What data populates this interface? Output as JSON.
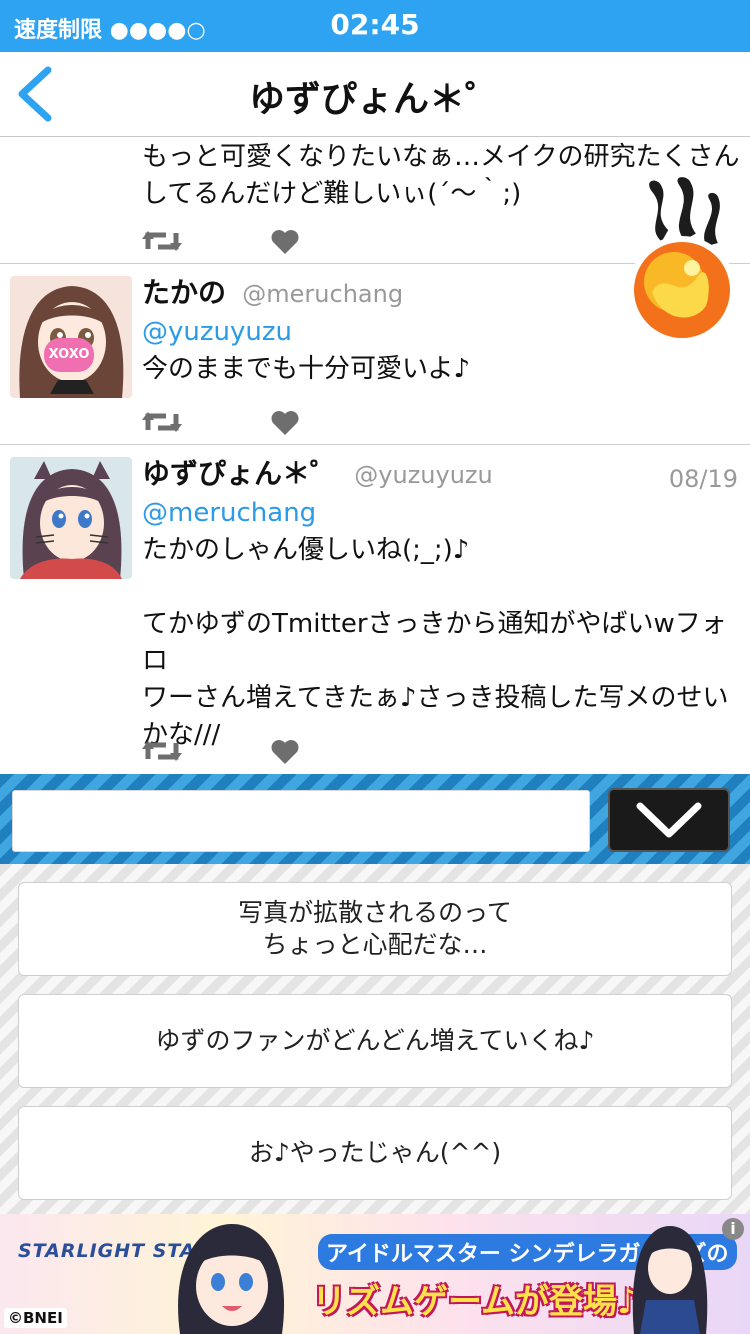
{
  "status_bar": {
    "carrier": "速度制限 ●●●●○",
    "time": "02:45"
  },
  "nav": {
    "title": "ゆずぴょん＊゜"
  },
  "tweets": [
    {
      "name": "",
      "handle": "",
      "date": "",
      "mention": "",
      "lines": [
        "もっと可愛くなりたいなぁ…メイクの研究たくさん",
        "してるんだけど難しいぃ(´〜｀;)"
      ]
    },
    {
      "name": "たかの",
      "handle": "@meruchang",
      "date": "",
      "mention": "@yuzuyuzu",
      "lines": [
        "今のままでも十分可愛いよ♪"
      ]
    },
    {
      "name": "ゆずぴょん＊゜",
      "handle": "@yuzuyuzu",
      "date": "08/19",
      "mention": "@meruchang",
      "lines": [
        "たかのしゃん優しいね(;_;)♪",
        "",
        "てかゆずのTmitterさっきから通知がやばいwフォロ",
        "ワーさん増えてきたぁ♪さっき投稿した写メのせい",
        "かな///"
      ]
    }
  ],
  "avatar_badge": "XOXO",
  "reply": {
    "input_value": ""
  },
  "choices": [
    {
      "line1": "写真が拡散されるのって",
      "line2": "ちょっと心配だな…"
    },
    {
      "line1": "ゆずのファンがどんどん増えていくね♪",
      "line2": ""
    },
    {
      "line1": "お♪やったじゃん(^^)",
      "line2": ""
    }
  ],
  "ad": {
    "logo": "STARLIGHT STAGE",
    "line1": "アイドルマスター シンデレラガールズの",
    "line2": "リズムゲームが登場♪",
    "copyright": "©BNEI",
    "info": "i"
  },
  "colors": {
    "accent": "#2ea3f2",
    "mention": "#2c9ae5",
    "icon_gray": "#6e6e6e"
  }
}
